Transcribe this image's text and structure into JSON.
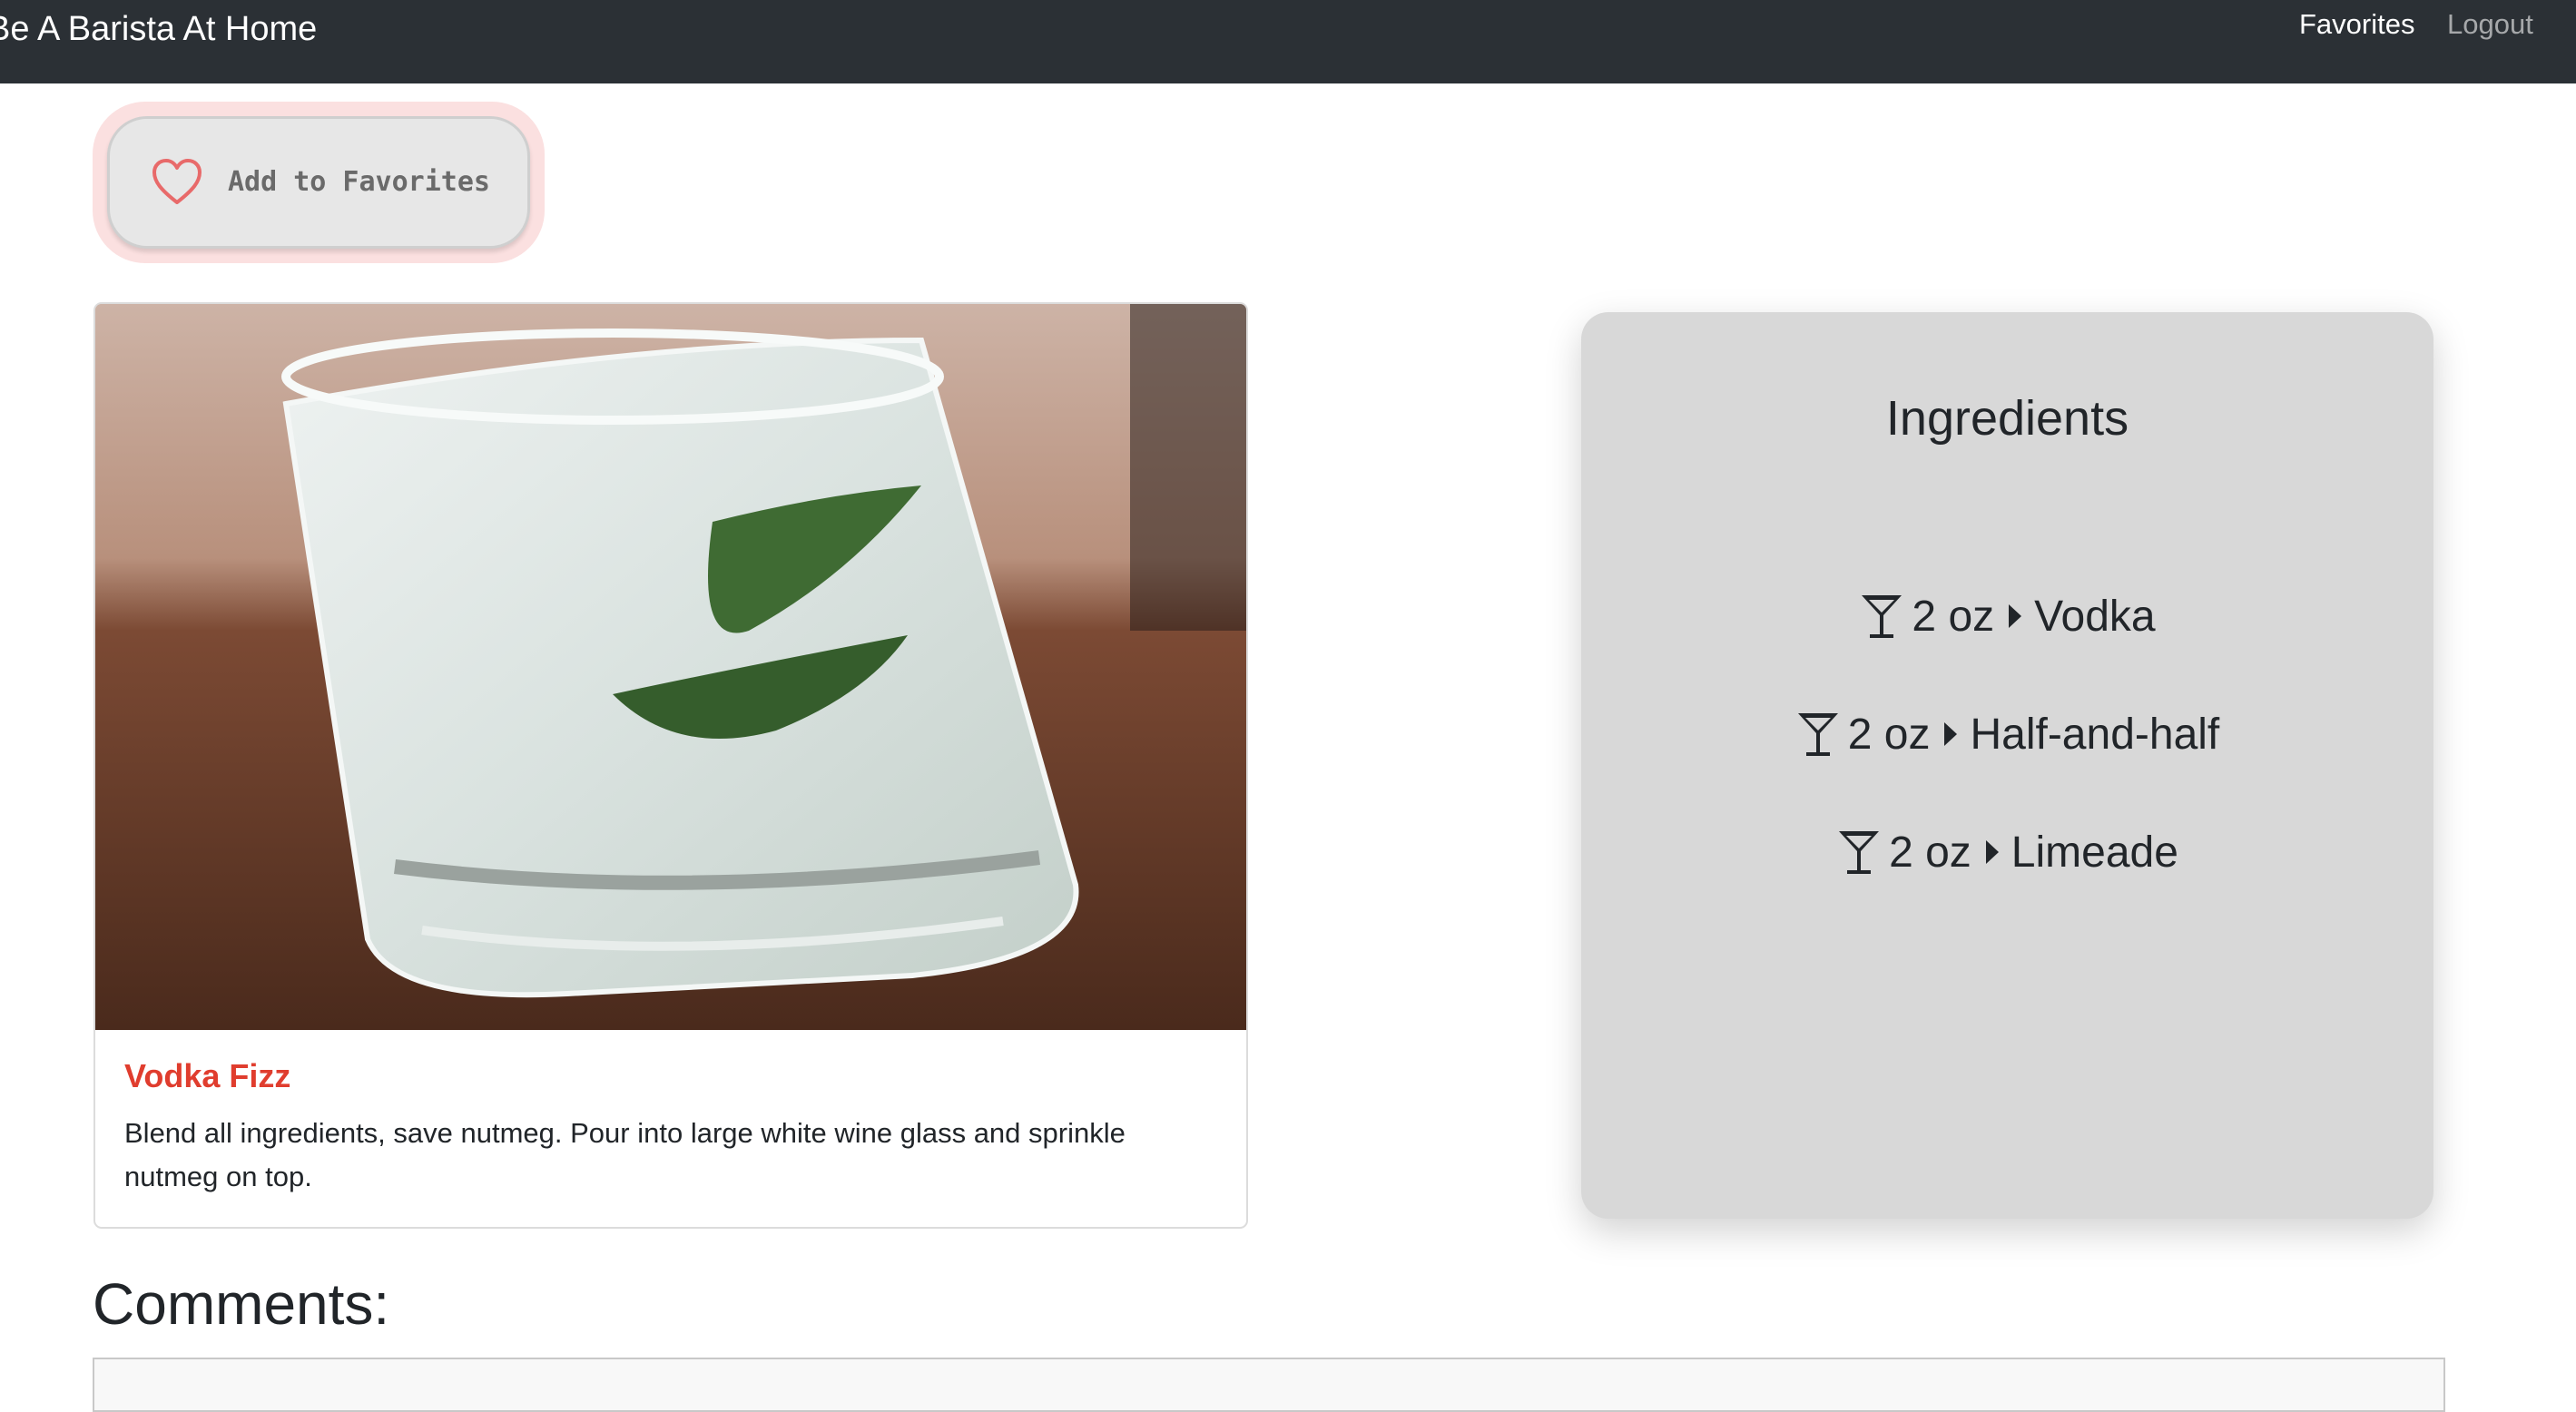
{
  "navbar": {
    "brand": "Be A Barista At Home",
    "links": [
      {
        "label": "Favorites"
      },
      {
        "label": "Logout"
      }
    ]
  },
  "favorite_button": {
    "label": "Add to Favorites",
    "icon": "heart-outline-icon"
  },
  "recipe": {
    "image_subject": "glass-with-ice-and-mint",
    "title": "Vodka Fizz",
    "instructions": "Blend all ingredients, save nutmeg. Pour into large white wine glass and sprinkle nutmeg on top."
  },
  "ingredients": {
    "title": "Ingredients",
    "items": [
      {
        "amount": "2 oz",
        "name": "Vodka"
      },
      {
        "amount": "2 oz",
        "name": "Half-and-half"
      },
      {
        "amount": "2 oz",
        "name": "Limeade"
      }
    ]
  },
  "comments": {
    "title": "Comments:"
  },
  "colors": {
    "navbar": "#2b3035",
    "recipe_title": "#e03d2e",
    "heart": "#e86a6a",
    "favorite_ring": "#fbe0e0",
    "ingredients_panel": "#d8d8d8"
  }
}
